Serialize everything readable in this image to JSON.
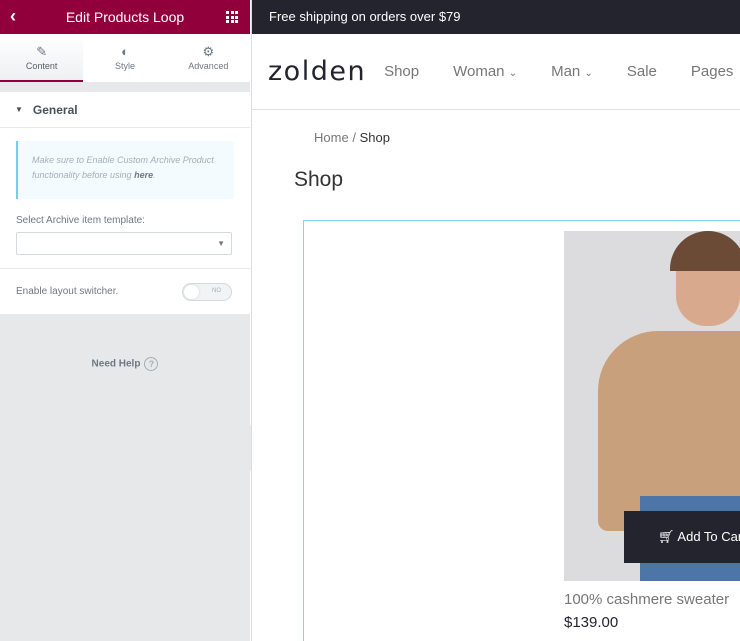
{
  "panel": {
    "title": "Edit Products Loop",
    "tabs": [
      {
        "label": "Content",
        "icon": "pencil-icon"
      },
      {
        "label": "Style",
        "icon": "half-circle-icon"
      },
      {
        "label": "Advanced",
        "icon": "gear-icon"
      }
    ],
    "section": "General",
    "notice_text": "Make sure to Enable Custom Archive Product functionality before using ",
    "notice_link": "here",
    "notice_end": ".",
    "template_label": "Select Archive item template:",
    "template_value": "",
    "switcher_label": "Enable layout switcher.",
    "switcher_state": "NO",
    "help": "Need Help",
    "accent": "#92003b"
  },
  "site": {
    "announcement": "Free shipping on orders over $79",
    "logo": "zolden",
    "nav": [
      "Shop",
      "Woman",
      "Man",
      "Sale",
      "Pages"
    ],
    "breadcrumb": {
      "home": "Home",
      "sep": "/",
      "current": "Shop"
    },
    "page_title": "Shop",
    "product": {
      "name": "100% cashmere sweater",
      "price": "$139.00",
      "cart": "Add To Cart"
    }
  }
}
